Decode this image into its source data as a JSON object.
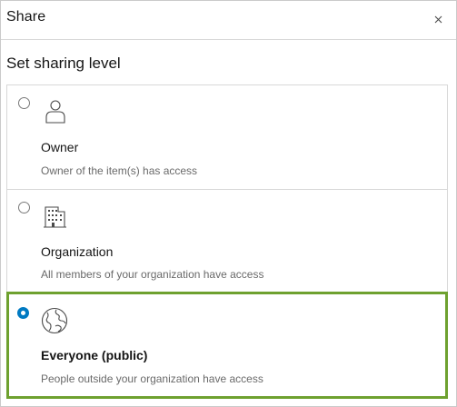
{
  "dialog": {
    "title": "Share",
    "close_icon": "close-icon"
  },
  "sharing": {
    "heading": "Set sharing level",
    "selected": "everyone",
    "options": [
      {
        "id": "owner",
        "label": "Owner",
        "description": "Owner of the item(s) has access",
        "icon": "user-icon",
        "checked": false
      },
      {
        "id": "organization",
        "label": "Organization",
        "description": "All members of your organization have access",
        "icon": "building-icon",
        "checked": false
      },
      {
        "id": "everyone",
        "label": "Everyone (public)",
        "description": "People outside your organization have access",
        "icon": "globe-icon",
        "checked": true
      }
    ]
  },
  "colors": {
    "accent": "#007ac2",
    "selected_border": "#6ea12f"
  }
}
